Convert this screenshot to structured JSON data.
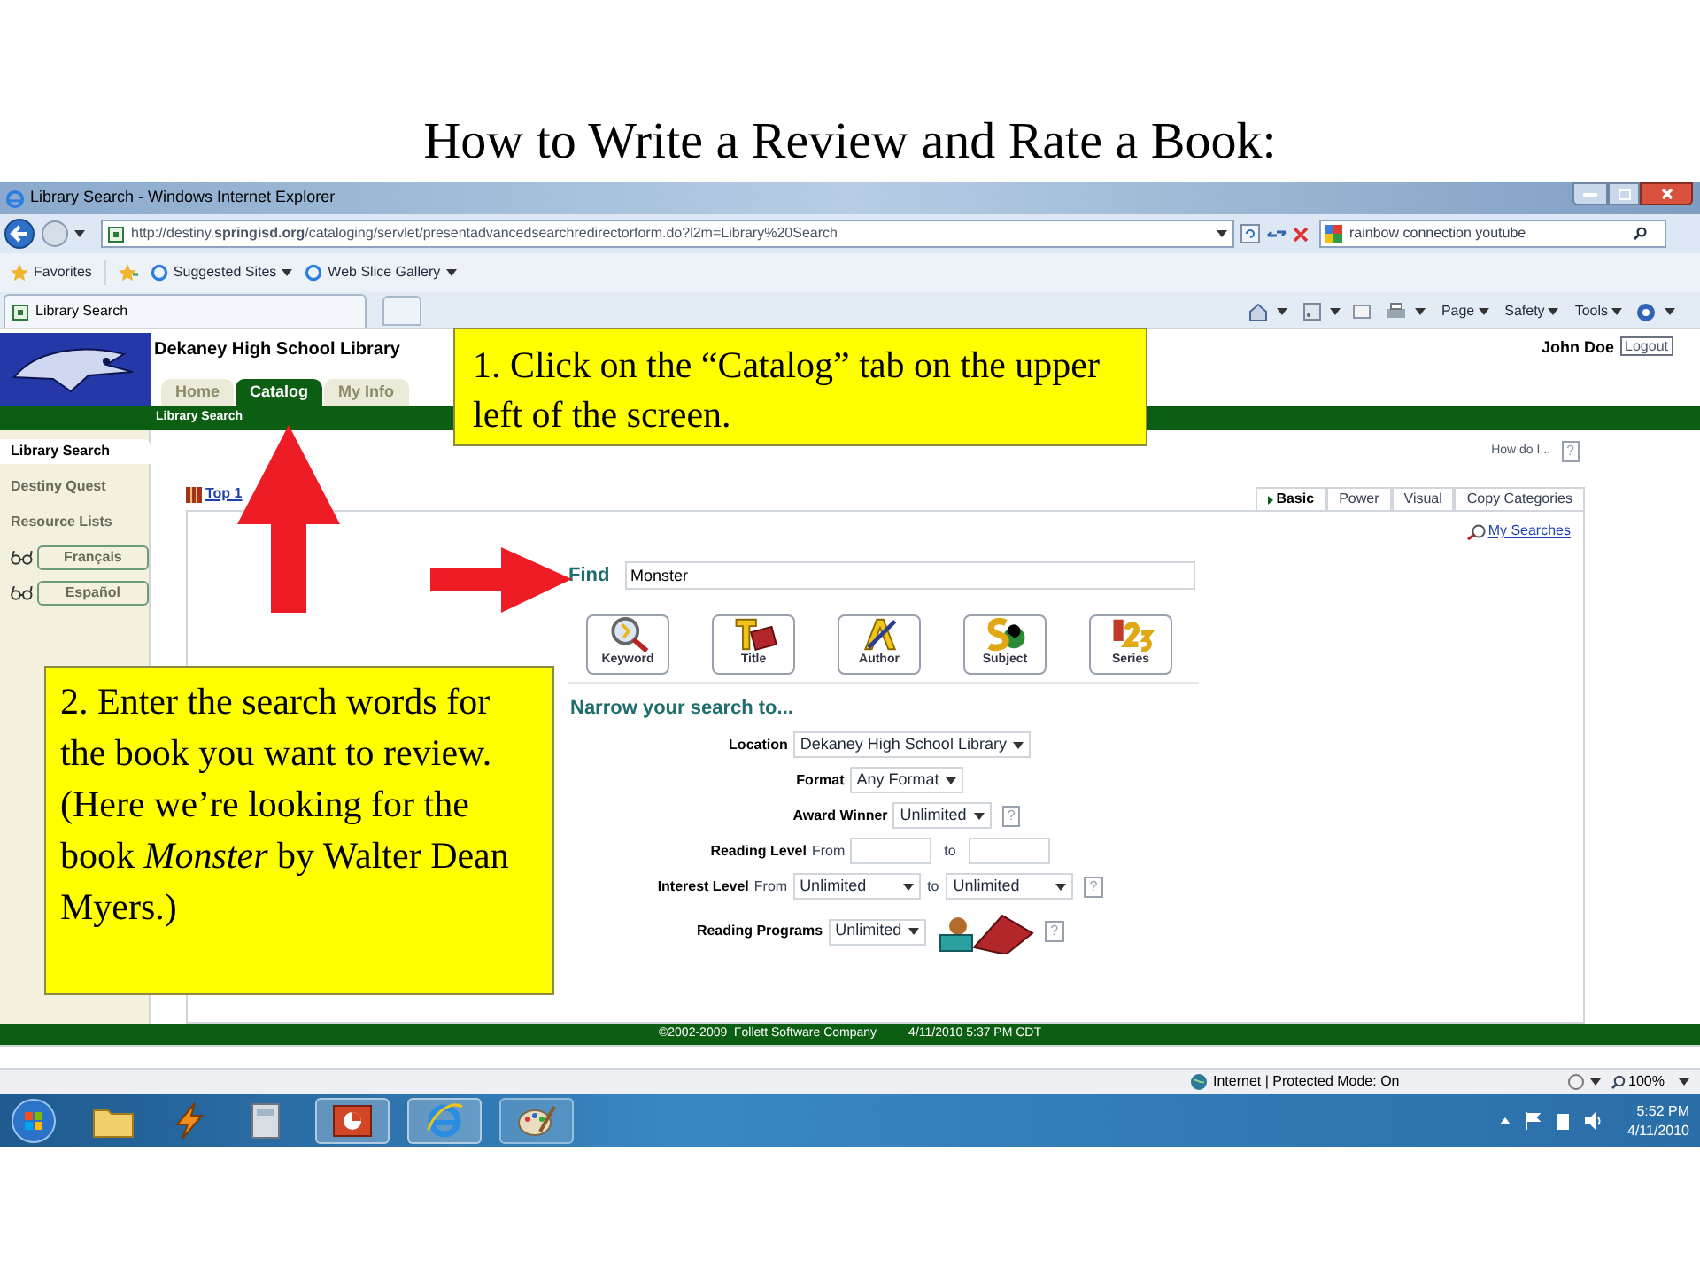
{
  "slide_title": "How to Write a Review and Rate a Book:",
  "browser": {
    "title": "Library Search - Windows Internet Explorer",
    "url": "http://destiny.**springisd.org**/cataloging/servlet/presentadvancedsearchredirectorform.do?l2m=Library%20Search",
    "search_value": "rainbow connection youtube",
    "favorites": [
      {
        "kind": "favorites",
        "label": "Favorites"
      },
      {
        "kind": "dropdown",
        "label": "Suggested Sites"
      },
      {
        "kind": "dropdown",
        "label": "Web Slice Gallery"
      }
    ],
    "tab": "Library Search",
    "commands": [
      "Page",
      "Safety",
      "Tools"
    ]
  },
  "page": {
    "school_name": "Dekaney High School Library",
    "user": "John Doe",
    "logout": "Logout",
    "tabs": [
      {
        "label": "Home",
        "selected": false
      },
      {
        "label": "Catalog",
        "selected": true
      },
      {
        "label": "My Info",
        "selected": false
      }
    ],
    "subnav": "Library Search",
    "sidebar": [
      {
        "kind": "link",
        "label": "Library Search",
        "selected": true
      },
      {
        "kind": "link",
        "label": "Destiny Quest",
        "selected": false
      },
      {
        "kind": "link",
        "label": "Resource Lists",
        "selected": false
      },
      {
        "kind": "language",
        "label": "Français",
        "selected": false
      },
      {
        "kind": "language",
        "label": "Español",
        "selected": false
      }
    ],
    "help_label": "How do I...",
    "help_mark": "?",
    "top_link": "Top 1",
    "search_tabs": [
      {
        "label": "Basic",
        "selected": true
      },
      {
        "label": "Power",
        "selected": false
      },
      {
        "label": "Visual",
        "selected": false
      },
      {
        "label": "Copy Categories",
        "selected": false
      }
    ],
    "my_searches": "My Searches",
    "find_label": "Find",
    "find_value": "Monster",
    "search_buttons": [
      {
        "kind": "keyword",
        "label": "Keyword"
      },
      {
        "kind": "title",
        "label": "Title"
      },
      {
        "kind": "author",
        "label": "Author"
      },
      {
        "kind": "subject",
        "label": "Subject"
      },
      {
        "kind": "series",
        "label": "Series"
      }
    ],
    "narrow_heading": "Narrow your search to...",
    "fields": [
      {
        "kind": "select",
        "label": "Location",
        "value": "Dekaney High School Library"
      },
      {
        "kind": "select",
        "label": "Format",
        "value": "Any Format"
      },
      {
        "kind": "select",
        "label": "Award Winner",
        "value": "Unlimited",
        "help": "?"
      },
      {
        "kind": "range_input",
        "label": "Reading Level",
        "from": "From",
        "to": "to"
      },
      {
        "kind": "range_select",
        "label": "Interest Level",
        "from": "From",
        "from_value": "Unlimited",
        "to": "to",
        "to_value": "Unlimited",
        "help": "?"
      },
      {
        "kind": "program_select",
        "label": "Reading Programs",
        "value": "Unlimited",
        "help": "?"
      }
    ],
    "footer": [
      "©2002-2009  Follett Software Company",
      "4/11/2010 5:37 PM CDT"
    ]
  },
  "status_bar": {
    "zone": "Internet | Protected Mode: On",
    "zoom": "100%"
  },
  "taskbar": {
    "time": "5:52 PM",
    "date": "4/11/2010"
  },
  "callouts": [
    {
      "text": "1.  Click on the “Catalog” tab on the upper left of the screen."
    },
    {
      "text": "2. Enter the search words for the book you want to review. (Here we’re looking for the book *Monster* by Walter Dean Myers.)"
    }
  ]
}
